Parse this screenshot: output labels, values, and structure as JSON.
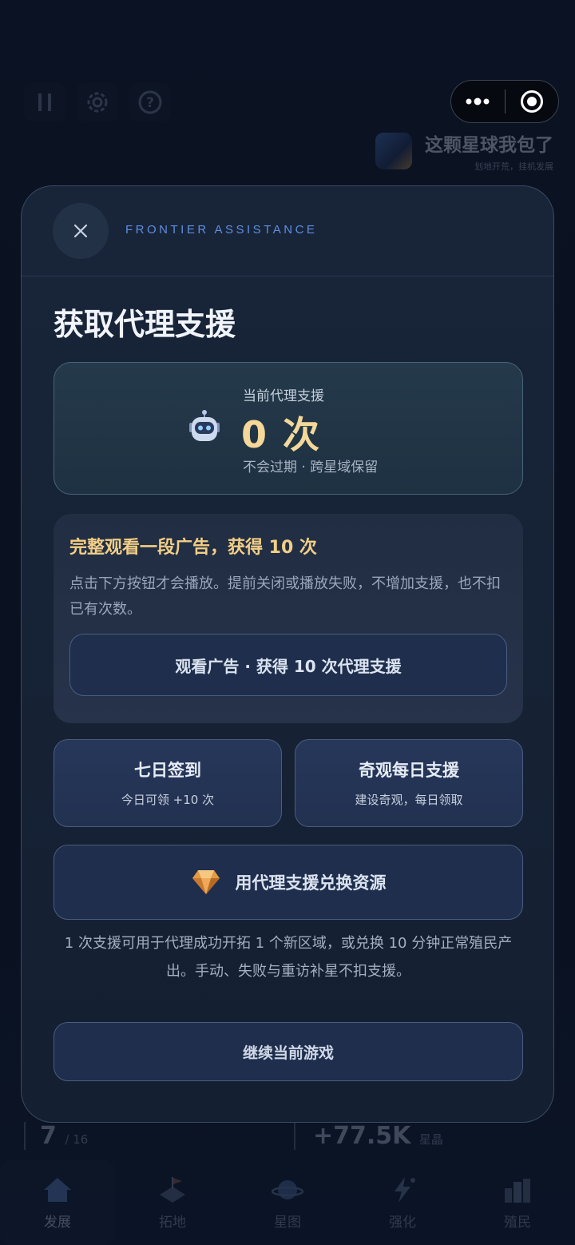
{
  "background": {
    "brand": {
      "title": "这颗星球我包了",
      "subtitle": "划地开荒，挂机发展"
    },
    "stats": {
      "regions_value": "7",
      "regions_total": "/ 16",
      "crystal_value": "+77.5K",
      "crystal_unit": "星晶"
    },
    "tabs": [
      {
        "label": "发展",
        "icon": "home-icon",
        "active": true
      },
      {
        "label": "拓地",
        "icon": "flag-icon",
        "active": false
      },
      {
        "label": "星图",
        "icon": "planet-icon",
        "active": false
      },
      {
        "label": "强化",
        "icon": "lightning-icon",
        "active": false
      },
      {
        "label": "殖民",
        "icon": "city-icon",
        "active": false
      }
    ]
  },
  "modal": {
    "eyebrow": "FRONTIER ASSISTANCE",
    "title": "获取代理支援",
    "counter": {
      "label": "当前代理支援",
      "value": "0 次",
      "sub": "不会过期 · 跨星域保留"
    },
    "ad": {
      "title": "完整观看一段广告，获得 10 次",
      "desc": "点击下方按钮才会播放。提前关闭或播放失败，不增加支援，也不扣已有次数。",
      "button": "观看广告 · 获得 10 次代理支援"
    },
    "checkin": {
      "title": "七日签到",
      "sub": "今日可领 +10 次"
    },
    "wonder": {
      "title": "奇观每日支援",
      "sub": "建设奇观，每日领取"
    },
    "exchange": "用代理支援兑换资源",
    "footnote": "1 次支援可用于代理成功开拓 1 个新区域，或兑换 10 分钟正常殖民产出。手动、失败与重访补星不扣支援。",
    "continue": "继续当前游戏"
  },
  "colors": {
    "accent_gold": "#f4d799",
    "eyebrow_blue": "#5f8de0",
    "panel": "#182539"
  }
}
